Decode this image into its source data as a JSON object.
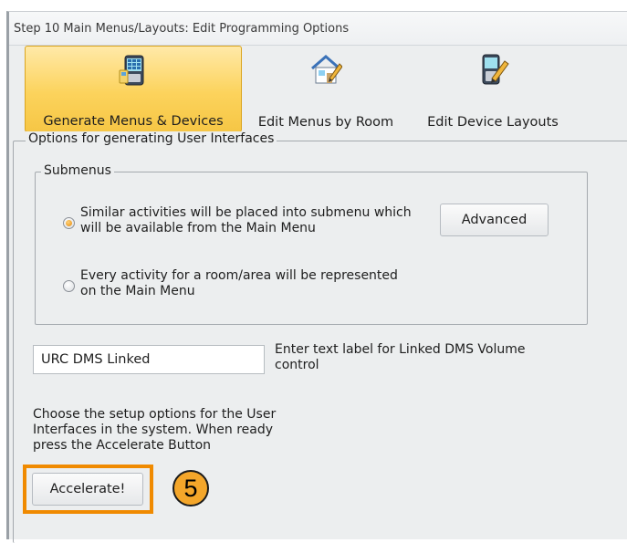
{
  "window": {
    "title": "Step 10 Main Menus/Layouts: Edit Programming Options"
  },
  "ribbon": {
    "items": [
      {
        "label": "Generate Menus & Devices",
        "icon": "remote-grid-icon",
        "active": true
      },
      {
        "label": "Edit Menus by Room",
        "icon": "house-edit-icon",
        "active": false
      },
      {
        "label": "Edit Device Layouts",
        "icon": "device-edit-icon",
        "active": false
      }
    ]
  },
  "options_group": {
    "title": "Options for generating User Interfaces"
  },
  "submenus": {
    "title": "Submenus",
    "option1_line1": "Similar activities will be placed into submenu which",
    "option1_line2": "will be available from the Main Menu",
    "option2_line1": "Every activity for a room/area will be represented",
    "option2_line2": "on the Main Menu",
    "selected": 1,
    "advanced_label": "Advanced"
  },
  "dms": {
    "value": "URC DMS Linked",
    "label_line1": "Enter text label for Linked DMS Volume",
    "label_line2": "control"
  },
  "instructions": {
    "line1": "Choose the setup options for the User",
    "line2": "Interfaces in the system. When ready",
    "line3": "press the Accelerate Button"
  },
  "accelerate_label": "Accelerate!",
  "annotation": {
    "step": "5",
    "color": "#f08a00"
  }
}
